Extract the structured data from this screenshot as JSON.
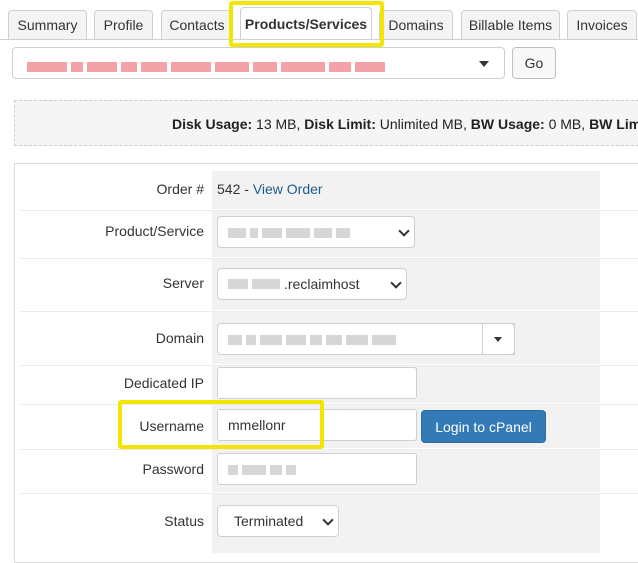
{
  "tabs": [
    {
      "label": "Summary"
    },
    {
      "label": "Profile"
    },
    {
      "label": "Contacts"
    },
    {
      "label": "Products/Services"
    },
    {
      "label": "Domains"
    },
    {
      "label": "Billable Items"
    },
    {
      "label": "Invoices"
    }
  ],
  "go_label": "Go",
  "usage": {
    "disk_usage_label": "Disk Usage:",
    "disk_usage_value": "13 MB,",
    "disk_limit_label": "Disk Limit:",
    "disk_limit_value": "Unlimited MB,",
    "bw_usage_label": "BW Usage:",
    "bw_usage_value": "0 MB,",
    "bw_limit_label": "BW Lim"
  },
  "form": {
    "order_label": "Order #",
    "order_number": "542 -",
    "view_order": "View Order",
    "product_label": "Product/Service",
    "server_label": "Server",
    "server_value": ".reclaimhost",
    "domain_label": "Domain",
    "dedicated_ip_label": "Dedicated IP",
    "dedicated_ip_value": "",
    "username_label": "Username",
    "username_value": "mmellonr",
    "login_cpanel": "Login to cPanel",
    "password_label": "Password",
    "status_label": "Status",
    "status_value": "Terminated"
  },
  "colors": {
    "highlight": "#f2e600",
    "primary_button": "#337ab7",
    "link": "#1f5b8f"
  }
}
